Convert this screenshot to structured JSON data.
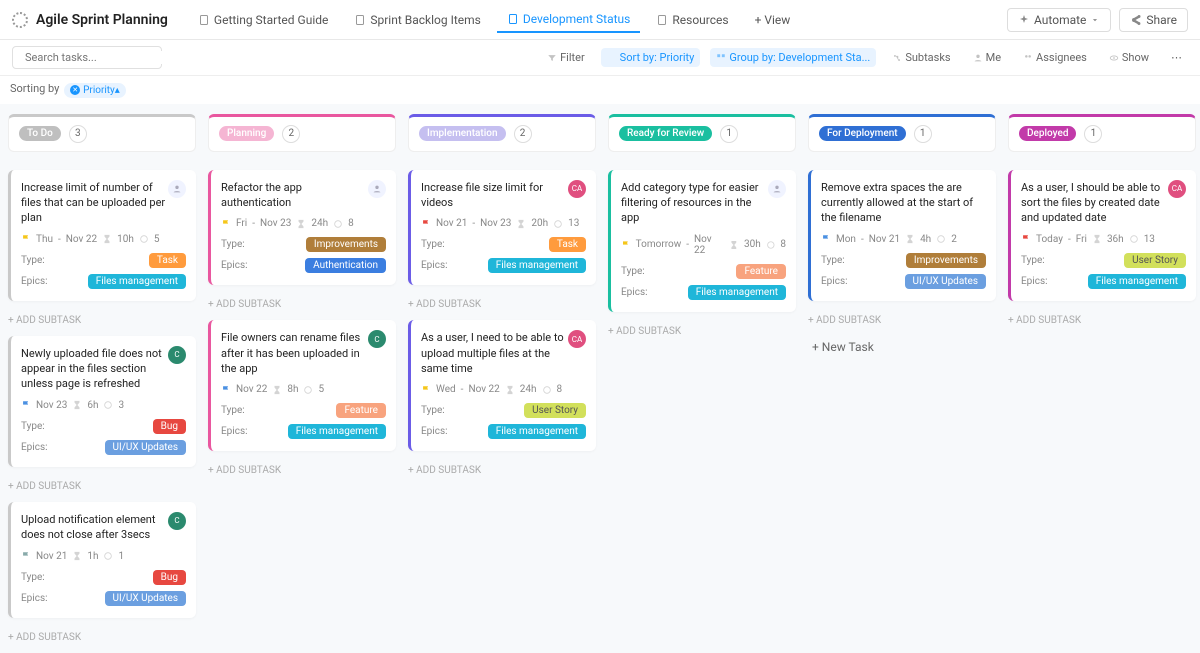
{
  "header": {
    "title": "Agile Sprint Planning",
    "tabs": [
      {
        "label": "Getting Started Guide"
      },
      {
        "label": "Sprint Backlog Items"
      },
      {
        "label": "Development Status",
        "active": true
      },
      {
        "label": "Resources"
      }
    ],
    "addView": "+ View",
    "automate": "Automate",
    "share": "Share"
  },
  "toolbar": {
    "searchPlaceholder": "Search tasks...",
    "filter": "Filter",
    "sort": "Sort by: Priority",
    "group": "Group by: Development Sta...",
    "subtasks": "Subtasks",
    "me": "Me",
    "assignees": "Assignees",
    "show": "Show"
  },
  "sorting": {
    "label": "Sorting by",
    "pill": "Priority"
  },
  "columns": [
    {
      "name": "To Do",
      "count": 3,
      "color": "#c9c9c9",
      "badgeBg": "#bfbfbf",
      "cards": [
        {
          "title": "Increase limit of number of files that can be uploaded per plan",
          "avatar": "un",
          "flag": "#f5c61a",
          "date": "Thu",
          "sep": "-",
          "date2": "Nov 22",
          "est": "10h",
          "sub": "5",
          "rows": [
            [
              "Type:",
              "Task",
              "p-task"
            ],
            [
              "Epics:",
              "Files management",
              "p-files"
            ]
          ]
        },
        {
          "title": "Newly uploaded file does not appear in the files section unless page is refreshed",
          "avatar": "cp",
          "flag": "#4a90e2",
          "date": "Nov 23",
          "est": "6h",
          "sub": "3",
          "rows": [
            [
              "Type:",
              "Bug",
              "p-bug"
            ],
            [
              "Epics:",
              "UI/UX Updates",
              "p-uiux"
            ]
          ]
        },
        {
          "title": "Upload notification element does not close after 3secs",
          "avatar": "cp",
          "flag": "#8aa",
          "date": "Nov 21",
          "est": "1h",
          "sub": "1",
          "rows": [
            [
              "Type:",
              "Bug",
              "p-bug"
            ],
            [
              "Epics:",
              "UI/UX Updates",
              "p-uiux"
            ]
          ]
        }
      ]
    },
    {
      "name": "Planning",
      "count": 2,
      "color": "#e9579f",
      "badgeBg": "#f5b5d3",
      "cards": [
        {
          "title": "Refactor the app authentication",
          "avatar": "un",
          "flag": "#f5c61a",
          "date": "Fri",
          "sep": "-",
          "date2": "Nov 23",
          "est": "24h",
          "sub": "8",
          "rows": [
            [
              "Type:",
              "Improvements",
              "p-improv"
            ],
            [
              "Epics:",
              "Authentication",
              "p-auth"
            ]
          ]
        },
        {
          "title": "File owners can rename files after it has been uploaded in the app",
          "avatar": "cp",
          "flag": "#4a90e2",
          "date": "Nov 22",
          "est": "8h",
          "sub": "5",
          "rows": [
            [
              "Type:",
              "Feature",
              "p-feature"
            ],
            [
              "Epics:",
              "Files management",
              "p-files"
            ]
          ]
        }
      ]
    },
    {
      "name": "Implementation",
      "count": 2,
      "color": "#6b5ce7",
      "badgeBg": "#c5bff0",
      "cards": [
        {
          "title": "Increase file size limit for videos",
          "avatar": "ca",
          "flag": "#e74840",
          "date": "Nov 21",
          "sep": "-",
          "date2": "Nov 23",
          "est": "20h",
          "sub": "13",
          "rows": [
            [
              "Type:",
              "Task",
              "p-task"
            ],
            [
              "Epics:",
              "Files management",
              "p-files"
            ]
          ]
        },
        {
          "title": "As a user, I need to be able to upload multiple files at the same time",
          "avatar": "ca",
          "flag": "#f5c61a",
          "date": "Wed",
          "sep": "-",
          "date2": "Nov 22",
          "est": "24h",
          "sub": "8",
          "rows": [
            [
              "Type:",
              "User Story",
              "p-story"
            ],
            [
              "Epics:",
              "Files management",
              "p-files"
            ]
          ]
        }
      ]
    },
    {
      "name": "Ready for Review",
      "count": 1,
      "color": "#1abfa0",
      "badgeBg": "#1abfa0",
      "cards": [
        {
          "title": "Add category type for easier filtering of resources in the app",
          "avatar": "un",
          "flag": "#f5c61a",
          "date": "Tomorrow",
          "sep": "-",
          "date2": "Nov 22",
          "est": "30h",
          "sub": "8",
          "rows": [
            [
              "Type:",
              "Feature",
              "p-feature"
            ],
            [
              "Epics:",
              "Files management",
              "p-files"
            ]
          ]
        }
      ]
    },
    {
      "name": "For Deployment",
      "count": 1,
      "color": "#2f6fd4",
      "badgeBg": "#2f6fd4",
      "cards": [
        {
          "title": "Remove extra spaces the are currently allowed at the start of the filename",
          "flag": "#4a90e2",
          "date": "Mon",
          "sep": "-",
          "date2": "Nov 21",
          "est": "4h",
          "sub": "2",
          "rows": [
            [
              "Type:",
              "Improvements",
              "p-improv"
            ],
            [
              "Epics:",
              "UI/UX Updates",
              "p-uiux"
            ]
          ]
        }
      ],
      "hasNewTask": true
    },
    {
      "name": "Deployed",
      "count": 1,
      "color": "#c23aa9",
      "badgeBg": "#c23aa9",
      "cards": [
        {
          "title": "As a user, I should be able to sort the files by created date and updated date",
          "avatar": "ca",
          "flag": "#e74840",
          "date": "Today",
          "sep": "-",
          "date2": "Fri",
          "est": "36h",
          "sub": "13",
          "rows": [
            [
              "Type:",
              "User Story",
              "p-story"
            ],
            [
              "Epics:",
              "Files management",
              "p-files"
            ]
          ]
        }
      ]
    }
  ],
  "addSubtask": "+ ADD SUBTASK",
  "newTask": "+ New Task"
}
